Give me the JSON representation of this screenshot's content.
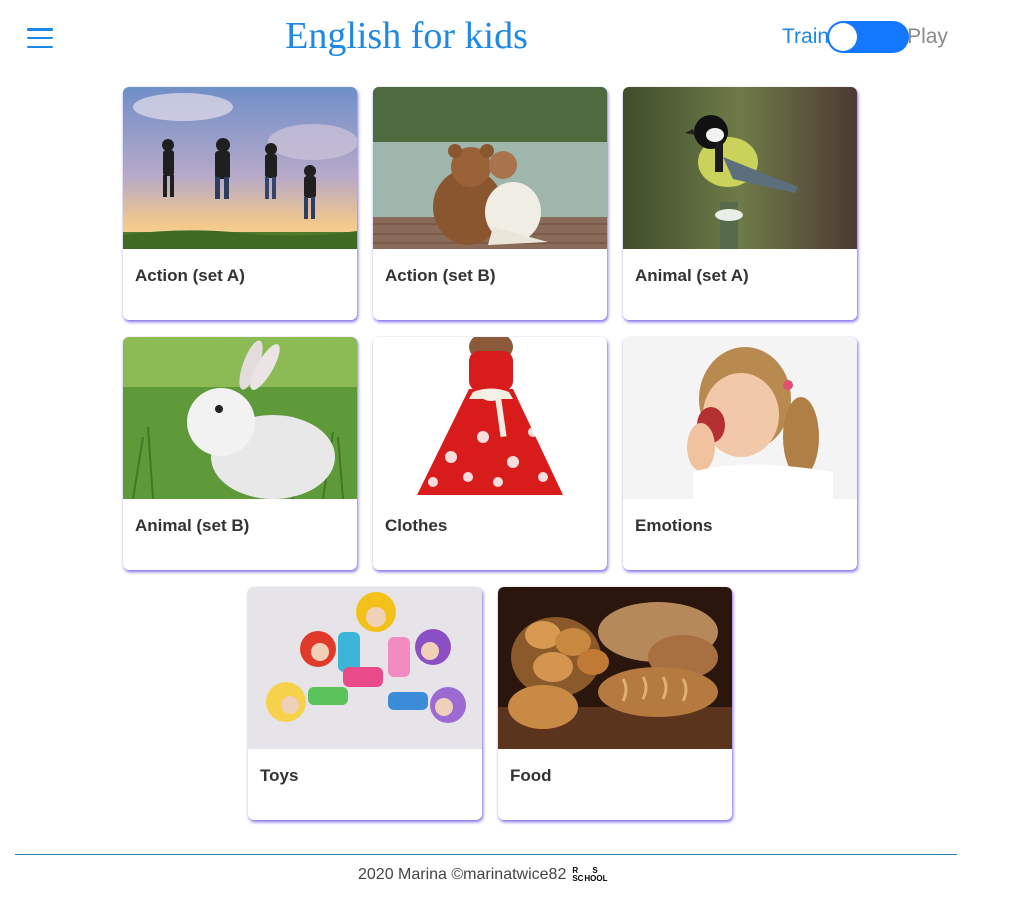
{
  "header": {
    "title": "English for kids",
    "mode_train": "Train",
    "mode_play": "Play"
  },
  "categories": [
    {
      "label": "Action (set A)",
      "icon": "kids-jumping-photo"
    },
    {
      "label": "Action (set B)",
      "icon": "teddy-bear-photo"
    },
    {
      "label": "Animal (set A)",
      "icon": "bird-photo"
    },
    {
      "label": "Animal (set B)",
      "icon": "rabbit-photo"
    },
    {
      "label": "Clothes",
      "icon": "red-dress-photo"
    },
    {
      "label": "Emotions",
      "icon": "yawning-girl-photo"
    },
    {
      "label": "Toys",
      "icon": "knitted-dolls-photo"
    },
    {
      "label": "Food",
      "icon": "bread-photo"
    }
  ],
  "footer": {
    "text": "2020 Marina ©marinatwice82",
    "logo_text": "RS SCHOOL"
  },
  "colors": {
    "accent": "#1e88e5",
    "switch": "#1478ff",
    "card_shadow": "#5a3ce6"
  }
}
